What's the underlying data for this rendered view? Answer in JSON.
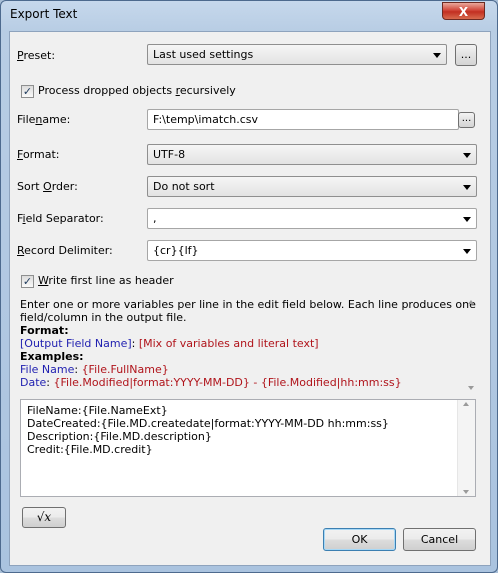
{
  "window": {
    "title": "Export Text",
    "close_glyph": "X"
  },
  "preset": {
    "label_accel": "P",
    "label_rest": "reset:",
    "value": "Last used settings",
    "btn_label": "..."
  },
  "recursive": {
    "checked": true,
    "text_a": "Process dropped objects ",
    "accel": "r",
    "text_b": "ecursively"
  },
  "filename": {
    "label_a": "File",
    "accel": "n",
    "label_b": "ame:",
    "value": "F:\\temp\\imatch.csv",
    "btn_label": "..."
  },
  "format": {
    "label_accel": "F",
    "label_rest": "ormat:",
    "value": "UTF-8"
  },
  "sort": {
    "label_a": "Sort ",
    "accel": "O",
    "label_b": "rder:",
    "value": "Do not sort"
  },
  "separator": {
    "label_a": "F",
    "accel": "i",
    "label_b": "eld Separator:",
    "value": ","
  },
  "delimiter": {
    "label_accel": "R",
    "label_rest": "ecord Delimiter:",
    "value": "{cr}{lf}"
  },
  "header": {
    "checked": true,
    "label_accel": "W",
    "label_rest": "rite first line as header"
  },
  "info": {
    "line1": "Enter one or more variables per line in the edit field below. Each line produces one",
    "line2": "field/column in the output file.",
    "format_heading": "Format:",
    "format_a": "[Output Field Name]",
    "format_sep": ": ",
    "format_b": "[Mix of variables and literal text]",
    "examples_heading": "Examples:",
    "ex1_a": "File Name",
    "ex1_sep": ": ",
    "ex1_b": "{File.FullName}",
    "ex2_a": "Date",
    "ex2_sep": ": ",
    "ex2_b": "{File.Modified|format:YYYY-MM-DD} - {File.Modified|hh:mm:ss}"
  },
  "editor": {
    "lines": [
      "FileName:{File.NameExt}",
      "DateCreated:{File.MD.createdate|format:YYYY-MM-DD hh:mm:ss}",
      "Description:{File.MD.description}",
      "Credit:{File.MD.credit}"
    ]
  },
  "sqrt_button": {
    "label": "√x",
    "icon": "sqrt-x-icon"
  },
  "ok_label": "OK",
  "cancel_label": "Cancel"
}
